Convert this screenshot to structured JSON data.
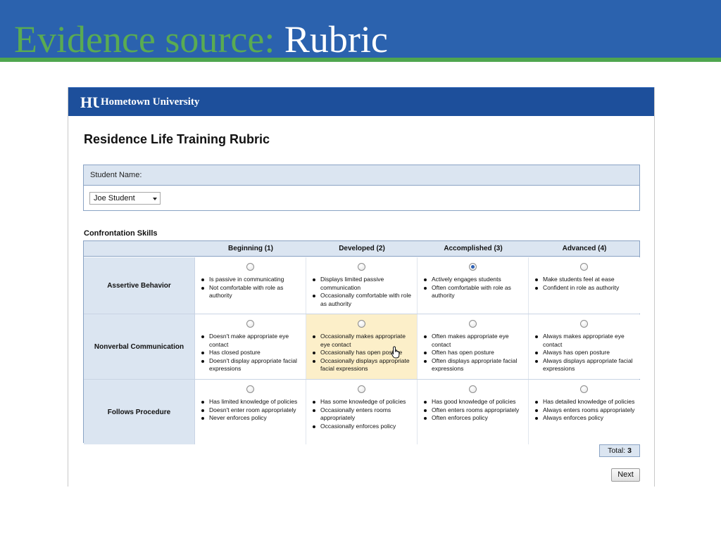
{
  "slide": {
    "title_prefix": "Evidence source: ",
    "title_suffix": "Rubric"
  },
  "app": {
    "university_name": "Hometown University",
    "logo_letters": "HU",
    "form_title": "Residence Life Training Rubric"
  },
  "student": {
    "label": "Student Name:",
    "selected": "Joe Student"
  },
  "section_title": "Confrontation Skills",
  "levels": [
    "Beginning (1)",
    "Developed (2)",
    "Accomplished (3)",
    "Advanced (4)"
  ],
  "criteria": [
    {
      "name": "Assertive Behavior",
      "selected_level": 3,
      "cells": [
        [
          "Is passive in communicating",
          "Not comfortable with role as authority"
        ],
        [
          "Displays limited passive communication",
          "Occasionally comfortable with role as authority"
        ],
        [
          "Actively engages students",
          "Often comfortable with role as authority"
        ],
        [
          "Make students feel at ease",
          "Confident in role as authority"
        ]
      ]
    },
    {
      "name": "Nonverbal Communication",
      "selected_level": null,
      "hover_level": 2,
      "cells": [
        [
          "Doesn't make appropriate eye contact",
          "Has closed posture",
          "Doesn't display appropriate facial expressions"
        ],
        [
          "Occasionally makes appropriate eye contact",
          "Occasionally has open posture",
          "Occasionally displays appropriate facial expressions"
        ],
        [
          "Often makes appropriate eye contact",
          "Often has open posture",
          "Often displays appropriate facial expressions"
        ],
        [
          "Always makes appropriate eye contact",
          "Always has open posture",
          "Always displays appropriate facial expressions"
        ]
      ]
    },
    {
      "name": "Follows Procedure",
      "selected_level": null,
      "cells": [
        [
          "Has limited knowledge of policies",
          "Doesn't enter room appropriately",
          "Never enforces policy"
        ],
        [
          "Has some knowledge of policies",
          "Occasionally enters rooms appropriately",
          "Occasionally enforces policy"
        ],
        [
          "Has good knowledge of policies",
          "Often enters rooms appropriately",
          "Often enforces policy"
        ],
        [
          "Has detailed knowledge of policies",
          "Always enters rooms appropriately",
          "Always enforces policy"
        ]
      ]
    }
  ],
  "total": {
    "label": "Total: ",
    "value": "3"
  },
  "next_label": "Next",
  "colors": {
    "slide_header": "#2b62ae",
    "slide_accent": "#4fa64f",
    "university_bar": "#1d4f9b",
    "table_header": "#dbe5f1",
    "hover_cell": "#fcefc9"
  }
}
